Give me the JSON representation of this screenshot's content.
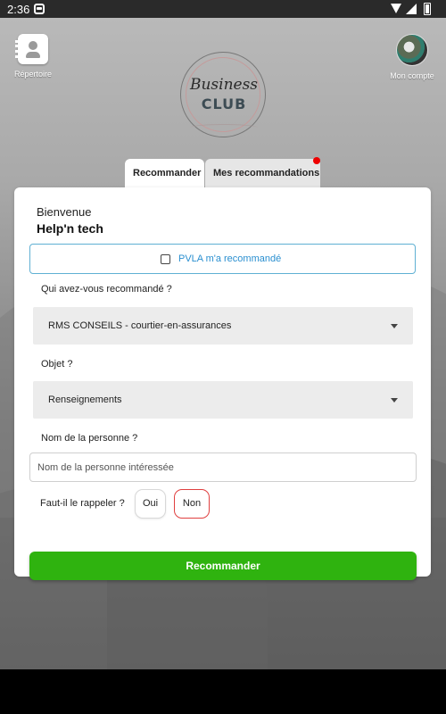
{
  "status_bar": {
    "time": "2:36"
  },
  "header": {
    "directory_label": "Répertoire",
    "account_label": "Mon compte",
    "logo": {
      "line1": "Business",
      "line2": "CLUB"
    }
  },
  "tabs": [
    {
      "label": "Recommander",
      "active": true
    },
    {
      "label": "Mes recommandations",
      "active": false,
      "notification": true
    }
  ],
  "form": {
    "welcome": "Bienvenue",
    "company": "Help'n tech",
    "recommended_by_label": "PVLA m'a recommandé",
    "recommended_by_checked": false,
    "who_label": "Qui avez-vous recommandé ?",
    "who_value": "RMS CONSEILS - courtier-en-assurances",
    "object_label": "Objet ?",
    "object_value": "Renseignements",
    "person_label": "Nom de la personne ?",
    "person_placeholder": "Nom de la personne intéressée",
    "person_value": "",
    "callback_label": "Faut-il le rappeler ?",
    "callback_yes": "Oui",
    "callback_no": "Non",
    "callback_selected": "Non",
    "submit_label": "Recommander"
  },
  "colors": {
    "accent_green": "#2fb30f",
    "link_blue": "#2a8fd0",
    "selected_border_red": "#e04040",
    "notification_red": "#e00000"
  }
}
